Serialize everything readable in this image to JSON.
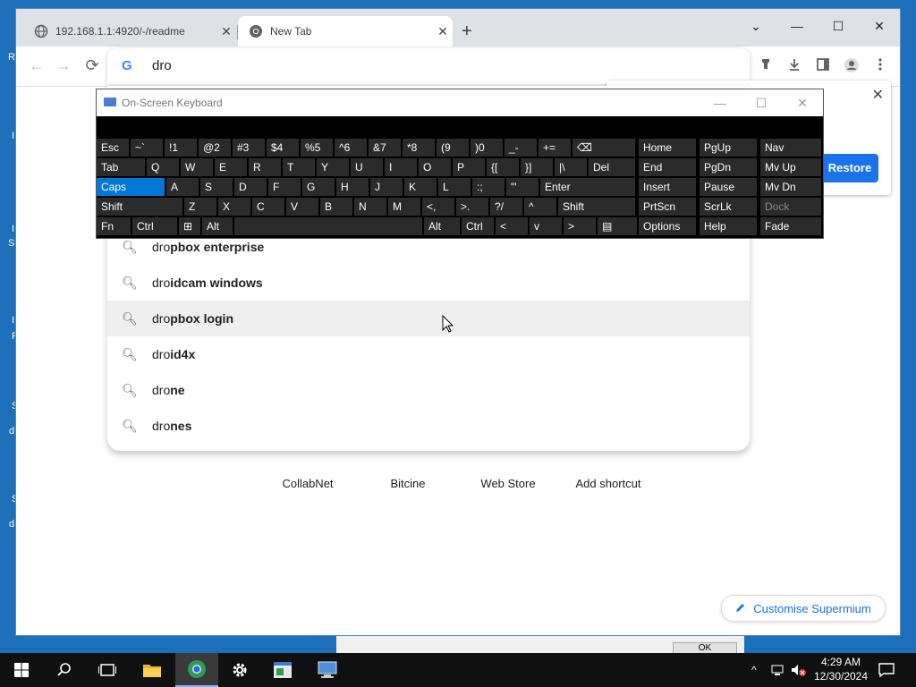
{
  "desktop": {
    "left_labels": [
      "R",
      "I",
      "I",
      "S",
      "I",
      "P",
      "S",
      "d",
      "S",
      "d"
    ]
  },
  "browser": {
    "tabs": [
      {
        "title": "192.168.1.1:4920/-/readme",
        "active": false,
        "icon": "globe-icon"
      },
      {
        "title": "New Tab",
        "active": true,
        "icon": "chromium-icon"
      }
    ],
    "new_tab_symbol": "+",
    "caption": {
      "dropdown": "⌄",
      "minimize": "—",
      "maximize": "☐",
      "close": "✕"
    },
    "nav": {
      "back": "←",
      "forward": "→",
      "reload": "⟳"
    },
    "omnibox": {
      "g_logo": "G",
      "value": "dro"
    },
    "toolbar_icons": [
      "extensions-icon",
      "download-icon",
      "sidepanel-icon",
      "profile-icon",
      "menu-icon"
    ],
    "suggestions": [
      {
        "typed": "dro",
        "completion": "pbox enterprise",
        "hover": false
      },
      {
        "typed": "dro",
        "completion": "idcam windows",
        "hover": false
      },
      {
        "typed": "dro",
        "completion": "pbox login",
        "hover": true
      },
      {
        "typed": "dro",
        "completion": "id4x",
        "hover": false
      },
      {
        "typed": "dro",
        "completion": "ne",
        "hover": false
      },
      {
        "typed": "dro",
        "completion": "nes",
        "hover": false
      }
    ],
    "restore": {
      "button": "Restore",
      "close": "✕"
    },
    "shortcuts": [
      "CollabNet",
      "Bitcine",
      "Web Store",
      "Add shortcut"
    ],
    "customise": "Customise Supermium"
  },
  "background_dialog": {
    "ok": "OK"
  },
  "osk": {
    "title": "On-Screen Keyboard",
    "caption": {
      "minimize": "—",
      "maximize": "☐",
      "close": "✕"
    },
    "rows": [
      [
        "Esc",
        "~`",
        "!1",
        "@2",
        "#3",
        "$4",
        "%5",
        "^6",
        "&7",
        "*8",
        "(9",
        ")0",
        "_-",
        "+=",
        "⌫",
        "Home",
        "PgUp",
        "Nav"
      ],
      [
        "Tab",
        "Q",
        "W",
        "E",
        "R",
        "T",
        "Y",
        "U",
        "I",
        "O",
        "P",
        "{[",
        "}]",
        "|\\",
        "Del",
        "End",
        "PgDn",
        "Mv Up"
      ],
      [
        "Caps",
        "A",
        "S",
        "D",
        "F",
        "G",
        "H",
        "J",
        "K",
        "L",
        ":;",
        "\"'",
        "Enter",
        "Insert",
        "Pause",
        "Mv Dn"
      ],
      [
        "Shift",
        "Z",
        "X",
        "C",
        "V",
        "B",
        "N",
        "M",
        "<,",
        ">.",
        "?/",
        "^",
        "Shift",
        "PrtScn",
        "ScrLk",
        "Dock"
      ],
      [
        "Fn",
        "Ctrl",
        "⊞",
        "Alt",
        "",
        "Alt",
        "Ctrl",
        "<",
        "v",
        ">",
        "▤",
        "Options",
        "Help",
        "Fade"
      ]
    ]
  },
  "taskbar": {
    "items": [
      "start-icon",
      "search-icon",
      "task-view-icon",
      "file-explorer-icon",
      "browser-icon",
      "settings-icon",
      "app-icon",
      "remote-icon"
    ],
    "clock_time": "4:29 AM",
    "clock_date": "12/30/2024",
    "tray": {
      "chevron": "^"
    }
  }
}
